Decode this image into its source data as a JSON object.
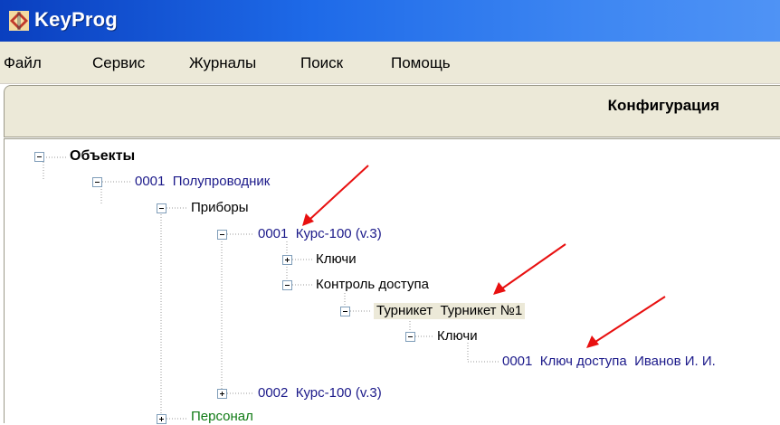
{
  "window": {
    "title": "KeyProg"
  },
  "menu": [
    "Файл",
    "Сервис",
    "Журналы",
    "Поиск",
    "Помощь"
  ],
  "panel": {
    "title": "Конфигурация"
  },
  "tree": {
    "root": "Объекты",
    "n1": {
      "id": "0001",
      "name": "Полупроводник"
    },
    "devices": "Приборы",
    "d1": {
      "id": "0001",
      "name": "Курс-100 (v.3)"
    },
    "d1_keys": "Ключи",
    "access": "Контроль доступа",
    "turnstile": {
      "type": "Турникет",
      "name": "Турникет №1"
    },
    "t_keys": "Ключи",
    "key": {
      "id": "0001",
      "type": "Ключ доступа",
      "owner": "Иванов И. И."
    },
    "d2": {
      "id": "0002",
      "name": "Курс-100 (v.3)"
    },
    "staff": "Персонал"
  },
  "colors": {
    "title_bar": "#1e6ae8",
    "node_text": "#1c1a8a",
    "staff_text": "#0f7a14",
    "arrow": "#e81010"
  }
}
